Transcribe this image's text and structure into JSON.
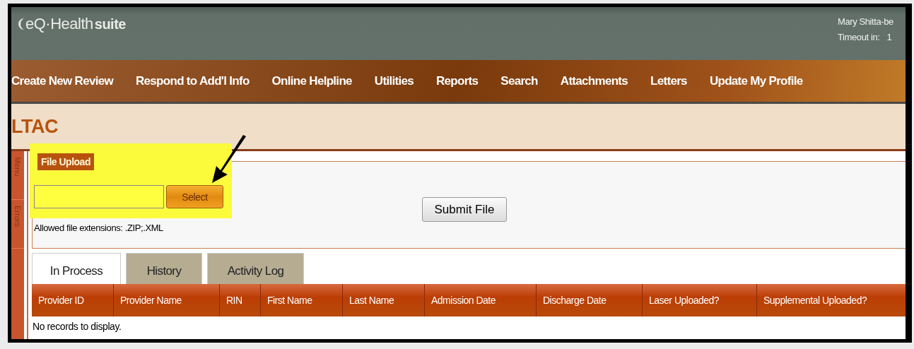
{
  "header": {
    "logo": {
      "light": "eQ·Health",
      "bold": "suite"
    },
    "user": "Mary Shitta-be",
    "timeout_label": "Timeout in:",
    "timeout_value": "1"
  },
  "nav": [
    "Create New Review",
    "Respond to Add'l Info",
    "Online Helpline",
    "Utilities",
    "Reports",
    "Search",
    "Attachments",
    "Letters",
    "Update My Profile"
  ],
  "page_title": "LTAC",
  "side_tabs": [
    "Menu",
    "Errors"
  ],
  "file_upload": {
    "legend": "File Upload",
    "select_button": "Select",
    "submit_button": "Submit File",
    "hint": "Allowed file extensions: .ZIP;.XML",
    "highlighted": true
  },
  "tabs": [
    {
      "label": "In Process",
      "selected": true
    },
    {
      "label": "History",
      "selected": false
    },
    {
      "label": "Activity Log",
      "selected": false
    }
  ],
  "table": {
    "columns": [
      "Provider ID",
      "Provider Name",
      "RIN",
      "First Name",
      "Last Name",
      "Admission Date",
      "Discharge Date",
      "Laser Uploaded?",
      "Supplemental Uploaded?"
    ],
    "empty_message": "No records to display."
  }
}
